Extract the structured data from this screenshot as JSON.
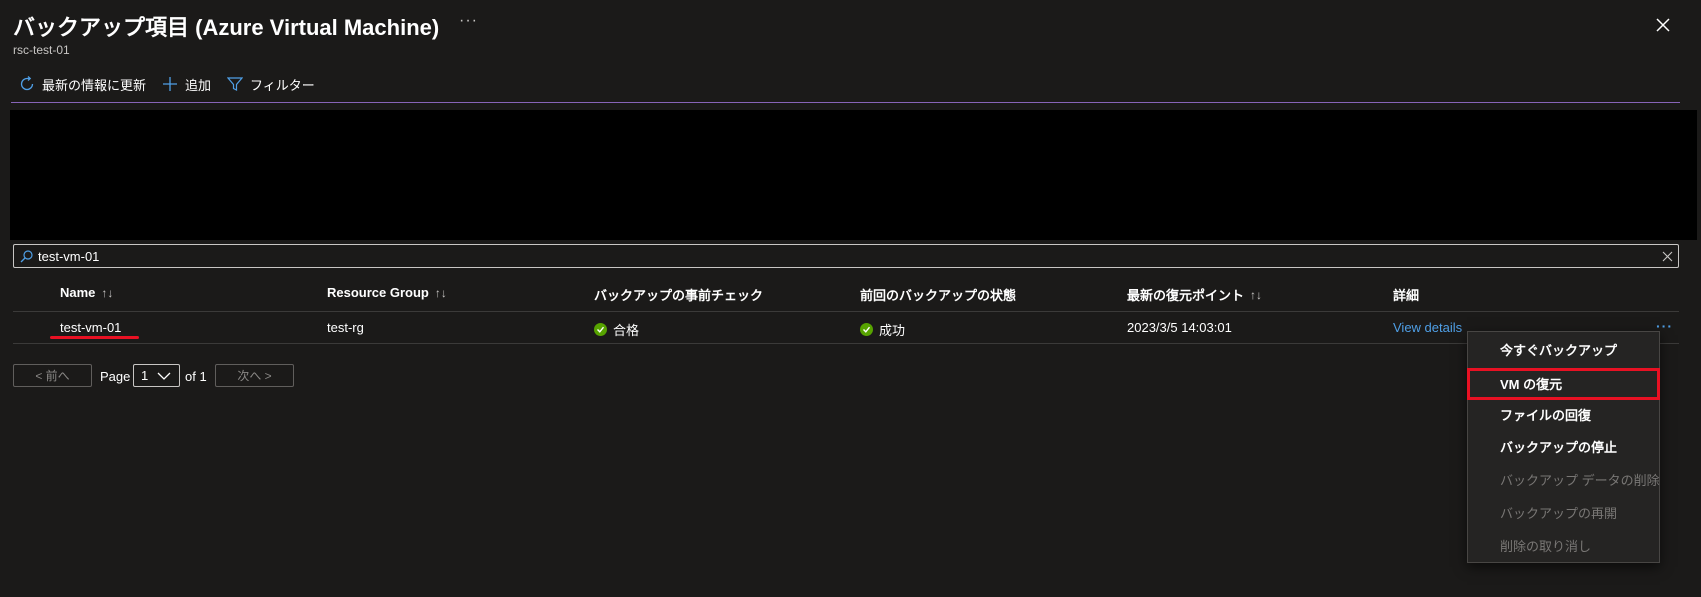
{
  "header": {
    "title": "バックアップ項目 (Azure Virtual Machine)",
    "more": "···",
    "subtitle": "rsc-test-01"
  },
  "toolbar": {
    "refresh_label": "最新の情報に更新",
    "add_label": "追加",
    "filter_label": "フィルター"
  },
  "search": {
    "value": "test-vm-01"
  },
  "table": {
    "columns": [
      {
        "label": "Name",
        "sortable": true
      },
      {
        "label": "Resource Group",
        "sortable": true
      },
      {
        "label": "バックアップの事前チェック",
        "sortable": false
      },
      {
        "label": "前回のバックアップの状態",
        "sortable": false
      },
      {
        "label": "最新の復元ポイント",
        "sortable": true
      },
      {
        "label": "詳細",
        "sortable": false
      }
    ],
    "sort_glyph": "↑↓",
    "rows": [
      {
        "name": "test-vm-01",
        "resource_group": "test-rg",
        "precheck": "合格",
        "last_backup_status": "成功",
        "latest_restore_point": "2023/3/5 14:03:01",
        "details": "View details",
        "more": "···"
      }
    ]
  },
  "pagination": {
    "prev_label": "< 前へ",
    "page_label": "Page",
    "page_value": "1",
    "of_label": "of 1",
    "next_label": "次へ >"
  },
  "context_menu": {
    "items": [
      {
        "label": "今すぐバックアップ",
        "enabled": true
      },
      {
        "label": "VM の復元",
        "enabled": true,
        "highlighted": true
      },
      {
        "label": "ファイルの回復",
        "enabled": true
      },
      {
        "label": "バックアップの停止",
        "enabled": true
      },
      {
        "label": "バックアップ データの削除",
        "enabled": false
      },
      {
        "label": "バックアップの再開",
        "enabled": false
      },
      {
        "label": "削除の取り消し",
        "enabled": false
      }
    ]
  },
  "colors": {
    "background": "#1b1a19",
    "accent_link": "#4f9fe6",
    "success": "#57a300",
    "annotation_red": "#e81123",
    "toolbar_divider": "#8764b8"
  },
  "icons": [
    "refresh-icon",
    "add-icon",
    "filter-icon",
    "search-icon",
    "clear-icon",
    "close-icon",
    "success-check-icon",
    "chevron-down-icon"
  ]
}
